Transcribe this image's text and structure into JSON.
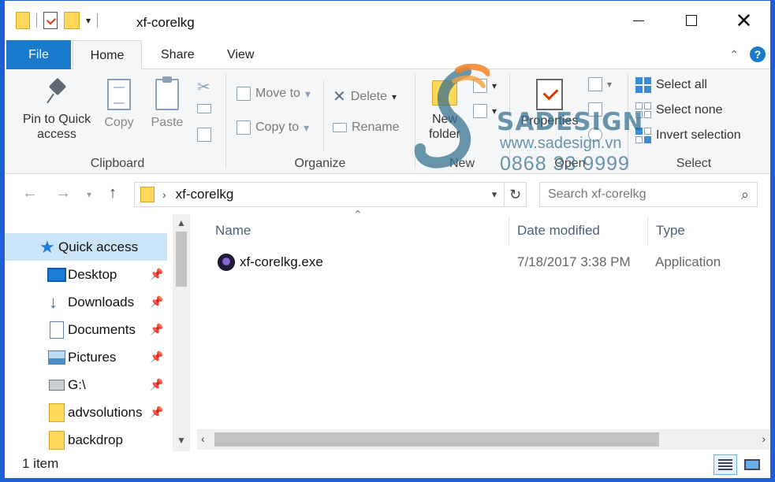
{
  "window": {
    "title": "xf-corelkg",
    "accent": "#1979ca"
  },
  "tabs": {
    "file": "File",
    "home": "Home",
    "share": "Share",
    "view": "View"
  },
  "ribbon": {
    "clipboard": {
      "label": "Clipboard",
      "pin_line1": "Pin to Quick",
      "pin_line2": "access",
      "copy": "Copy",
      "paste": "Paste"
    },
    "organize": {
      "label": "Organize",
      "move_to": "Move to",
      "copy_to": "Copy to",
      "delete": "Delete",
      "rename": "Rename"
    },
    "new": {
      "label": "New",
      "new_folder_line1": "New",
      "new_folder_line2": "folder"
    },
    "open": {
      "label": "Open",
      "properties": "Properties"
    },
    "select": {
      "label": "Select",
      "select_all": "Select all",
      "select_none": "Select none",
      "invert": "Invert selection"
    }
  },
  "watermark": {
    "brand": "SADESIGN",
    "url": "www.sadesign.vn",
    "phone": "0868 33 9999"
  },
  "navigation": {
    "path": "xf-corelkg",
    "search_placeholder": "Search xf-corelkg"
  },
  "sidebar": {
    "items": [
      {
        "label": "Quick access",
        "icon": "star-icon",
        "pinned": false
      },
      {
        "label": "Desktop",
        "icon": "desktop-icon",
        "pinned": true
      },
      {
        "label": "Downloads",
        "icon": "download-icon",
        "pinned": true
      },
      {
        "label": "Documents",
        "icon": "documents-icon",
        "pinned": true
      },
      {
        "label": "Pictures",
        "icon": "pictures-icon",
        "pinned": true
      },
      {
        "label": "G:\\",
        "icon": "drive-icon",
        "pinned": true
      },
      {
        "label": "advsolutions",
        "icon": "folder-icon",
        "pinned": true
      },
      {
        "label": "backdrop",
        "icon": "folder-icon",
        "pinned": false
      }
    ]
  },
  "filelist": {
    "columns": [
      "Name",
      "Date modified",
      "Type"
    ],
    "rows": [
      {
        "name": "xf-corelkg.exe",
        "date": "7/18/2017 3:38 PM",
        "type": "Application"
      }
    ]
  },
  "status": {
    "count": "1 item"
  }
}
